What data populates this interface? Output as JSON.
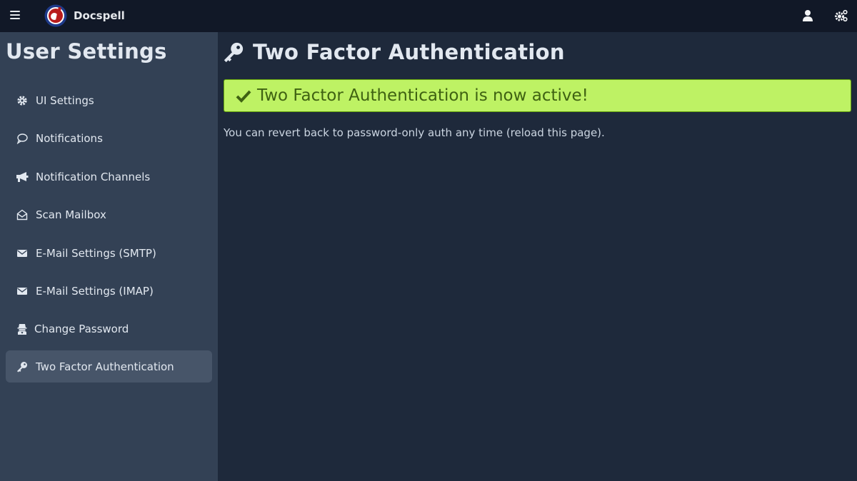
{
  "app": {
    "brand": "Docspell"
  },
  "colors": {
    "topbar": "#111827",
    "sidebar": "#334155",
    "main": "#1e293b",
    "success_bg": "#bef264",
    "success_text": "#3f6212",
    "logo_red": "#b91c1c"
  },
  "topbar": {
    "menu_icon": "hamburger-icon",
    "user_icon": "user-icon",
    "settings_icon": "cogs-icon"
  },
  "sidebar": {
    "title": "User Settings",
    "items": [
      {
        "label": "UI Settings",
        "icon": "cog-icon",
        "active": false
      },
      {
        "label": "Notifications",
        "icon": "comment-icon",
        "active": false
      },
      {
        "label": "Notification Channels",
        "icon": "bullhorn-icon",
        "active": false
      },
      {
        "label": "Scan Mailbox",
        "icon": "envelope-open-icon",
        "active": false
      },
      {
        "label": "E-Mail Settings (SMTP)",
        "icon": "envelope-icon",
        "active": false
      },
      {
        "label": "E-Mail Settings (IMAP)",
        "icon": "envelope-icon",
        "active": false
      },
      {
        "label": "Change Password",
        "icon": "user-secret-icon",
        "active": false
      },
      {
        "label": "Two Factor Authentication",
        "icon": "key-icon",
        "active": true
      }
    ]
  },
  "main": {
    "title": "Two Factor Authentication",
    "success_message": "Two Factor Authentication is now active!",
    "info": "You can revert back to password-only auth any time (reload this page)."
  }
}
